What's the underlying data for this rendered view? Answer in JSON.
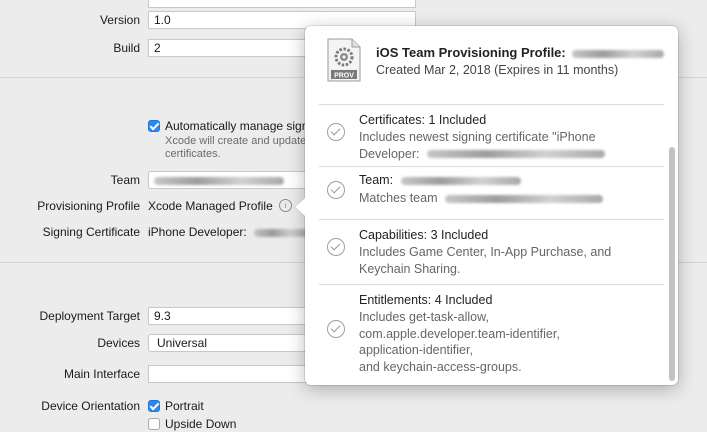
{
  "identity": {
    "version_label": "Version",
    "version_value": "1.0",
    "build_label": "Build",
    "build_value": "2"
  },
  "signing": {
    "auto_manage_label": "Automatically manage signi",
    "auto_manage_checked": true,
    "auto_manage_hint_line1": "Xcode will create and update",
    "auto_manage_hint_line2": "certificates.",
    "team_label": "Team",
    "provisioning_label": "Provisioning Profile",
    "provisioning_value": "Xcode Managed Profile",
    "certificate_label": "Signing Certificate",
    "certificate_value": "iPhone Developer:"
  },
  "deployment": {
    "target_label": "Deployment Target",
    "target_value": "9.3",
    "devices_label": "Devices",
    "devices_value": "Universal",
    "main_interface_label": "Main Interface",
    "main_interface_value": "",
    "orientation_label": "Device Orientation",
    "portrait_label": "Portrait",
    "portrait_checked": true,
    "upside_down_label": "Upside Down",
    "upside_down_checked": false
  },
  "popover": {
    "icon_text": "PROV",
    "title": "iOS Team Provisioning Profile:",
    "subtitle": "Created Mar 2, 2018 (Expires in 11 months)",
    "sections": [
      {
        "title": "Certificates: 1 Included",
        "body": "Includes newest signing certificate \"iPhone",
        "body2": "Developer:"
      },
      {
        "title": "Team:",
        "body": "Matches team"
      },
      {
        "title": "Capabilities: 3 Included",
        "body": "Includes Game Center, In-App Purchase, and",
        "body2": "Keychain Sharing."
      },
      {
        "title": "Entitlements: 4 Included",
        "body": "Includes get-task-allow,",
        "body2": "com.apple.developer.team-identifier,",
        "body3": "application-identifier,",
        "body4": "and keychain-access-groups."
      }
    ]
  },
  "colors": {
    "accent": "#2a88f0",
    "window_bg": "#ececec"
  }
}
